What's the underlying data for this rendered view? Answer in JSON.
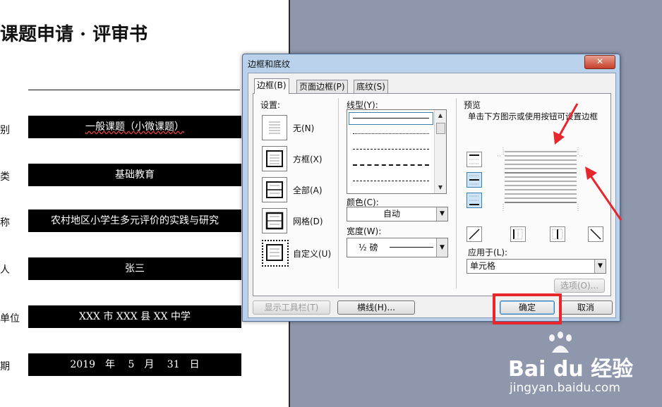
{
  "document": {
    "title": "课题申请 · 评审书",
    "fields": [
      {
        "label": "别",
        "value": "一般课题（小微课题）"
      },
      {
        "label": "类",
        "value": "基础教育"
      },
      {
        "label": "称",
        "value": "农村地区小学生多元评价的实践与研究"
      },
      {
        "label": "人",
        "value": "张三"
      },
      {
        "label": "单位",
        "value": "XXX 市 XXX 县 XX 中学"
      },
      {
        "label": "期",
        "value": "2019　年　 5　月　 31　日"
      }
    ]
  },
  "dialog": {
    "title": "边框和底纹",
    "close_label": "✕",
    "tabs": [
      {
        "label": "边框(B)",
        "active": true
      },
      {
        "label": "页面边框(P)",
        "active": false
      },
      {
        "label": "底纹(S)",
        "active": false
      }
    ],
    "settings": {
      "header": "设置:",
      "presets": [
        {
          "label": "无(N)"
        },
        {
          "label": "方框(X)"
        },
        {
          "label": "全部(A)"
        },
        {
          "label": "网格(D)"
        },
        {
          "label": "自定义(U)",
          "selected": true
        }
      ]
    },
    "line_style": {
      "header": "线型(Y):"
    },
    "color": {
      "header": "颜色(C):",
      "value": "自动"
    },
    "width": {
      "header": "宽度(W):",
      "value": "½ 磅"
    },
    "preview": {
      "header": "预览",
      "hint": "单击下方图示或使用按钮可设置边框"
    },
    "apply_to": {
      "header": "应用于(L):",
      "value": "单元格"
    },
    "options_button": "选项(O)...",
    "show_toolbar_button": "显示工具栏(T)",
    "horizontal_line_button": "横线(H)...",
    "ok_button": "确定",
    "cancel_button": "取消"
  },
  "watermark": {
    "logo": "Bai du 经验",
    "url": "jingyan.baidu.com"
  },
  "colors": {
    "desktop": "#8f97ad",
    "dialog_frame": "#b9d1ea",
    "highlight_red": "#e8262b",
    "annotation_arrow": "#e8262b"
  }
}
